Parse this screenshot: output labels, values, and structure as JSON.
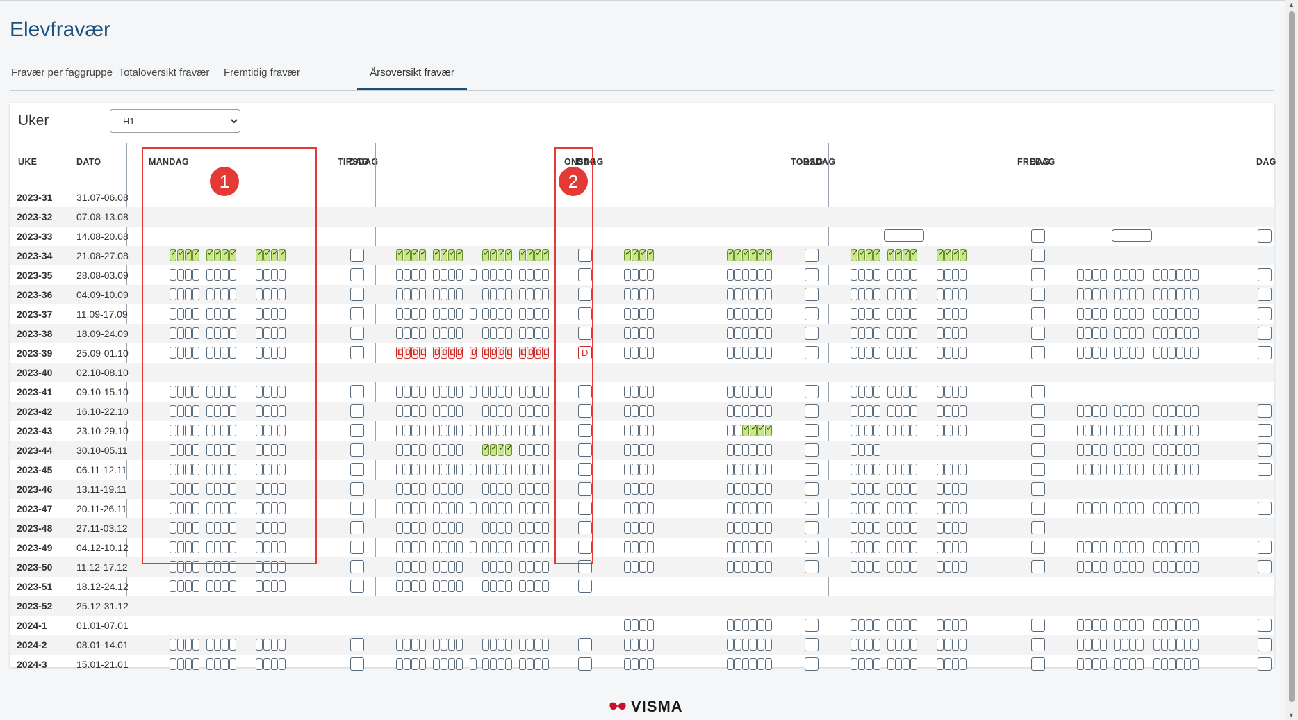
{
  "page": {
    "title": "Elevfravær"
  },
  "tabs": [
    {
      "label": "Fravær per faggruppe",
      "active": false
    },
    {
      "label": "Totaloversikt fravær",
      "active": false
    },
    {
      "label": "Fremtidig fravær",
      "active": false
    },
    {
      "label": "Årsoversikt fravær",
      "active": true
    }
  ],
  "filter": {
    "label": "Uker",
    "selected": "H1"
  },
  "columns": {
    "uke": "UKE",
    "dato": "DATO",
    "mon": "MANDAG",
    "tue": "TIRSDAG",
    "wed": "ONSDAG",
    "thu": "TORSDAG",
    "fri": "FREDAG",
    "dag": "DAG"
  },
  "annotations": [
    "1",
    "2"
  ],
  "footer": {
    "logo_text": "VISMA",
    "logo_color": "#c8102e"
  },
  "legend": {
    "absent_mark": "D"
  },
  "rows": [
    {
      "uke": "2023-31",
      "dato": "31.07-06.08"
    },
    {
      "uke": "2023-32",
      "dato": "07.08-13.08"
    },
    {
      "uke": "2023-33",
      "dato": "14.08-20.08"
    },
    {
      "uke": "2023-34",
      "dato": "21.08-27.08"
    },
    {
      "uke": "2023-35",
      "dato": "28.08-03.09"
    },
    {
      "uke": "2023-36",
      "dato": "04.09-10.09"
    },
    {
      "uke": "2023-37",
      "dato": "11.09-17.09"
    },
    {
      "uke": "2023-38",
      "dato": "18.09-24.09"
    },
    {
      "uke": "2023-39",
      "dato": "25.09-01.10"
    },
    {
      "uke": "2023-40",
      "dato": "02.10-08.10"
    },
    {
      "uke": "2023-41",
      "dato": "09.10-15.10"
    },
    {
      "uke": "2023-42",
      "dato": "16.10-22.10"
    },
    {
      "uke": "2023-43",
      "dato": "23.10-29.10"
    },
    {
      "uke": "2023-44",
      "dato": "30.10-05.11"
    },
    {
      "uke": "2023-45",
      "dato": "06.11-12.11"
    },
    {
      "uke": "2023-46",
      "dato": "13.11-19.11"
    },
    {
      "uke": "2023-47",
      "dato": "20.11-26.11"
    },
    {
      "uke": "2023-48",
      "dato": "27.11-03.12"
    },
    {
      "uke": "2023-49",
      "dato": "04.12-10.12"
    },
    {
      "uke": "2023-50",
      "dato": "11.12-17.12"
    },
    {
      "uke": "2023-51",
      "dato": "18.12-24.12"
    },
    {
      "uke": "2023-52",
      "dato": "25.12-31.12"
    },
    {
      "uke": "2024-1",
      "dato": "01.01-07.01"
    },
    {
      "uke": "2024-2",
      "dato": "08.01-14.01"
    },
    {
      "uke": "2024-3",
      "dato": "15.01-21.01"
    }
  ]
}
